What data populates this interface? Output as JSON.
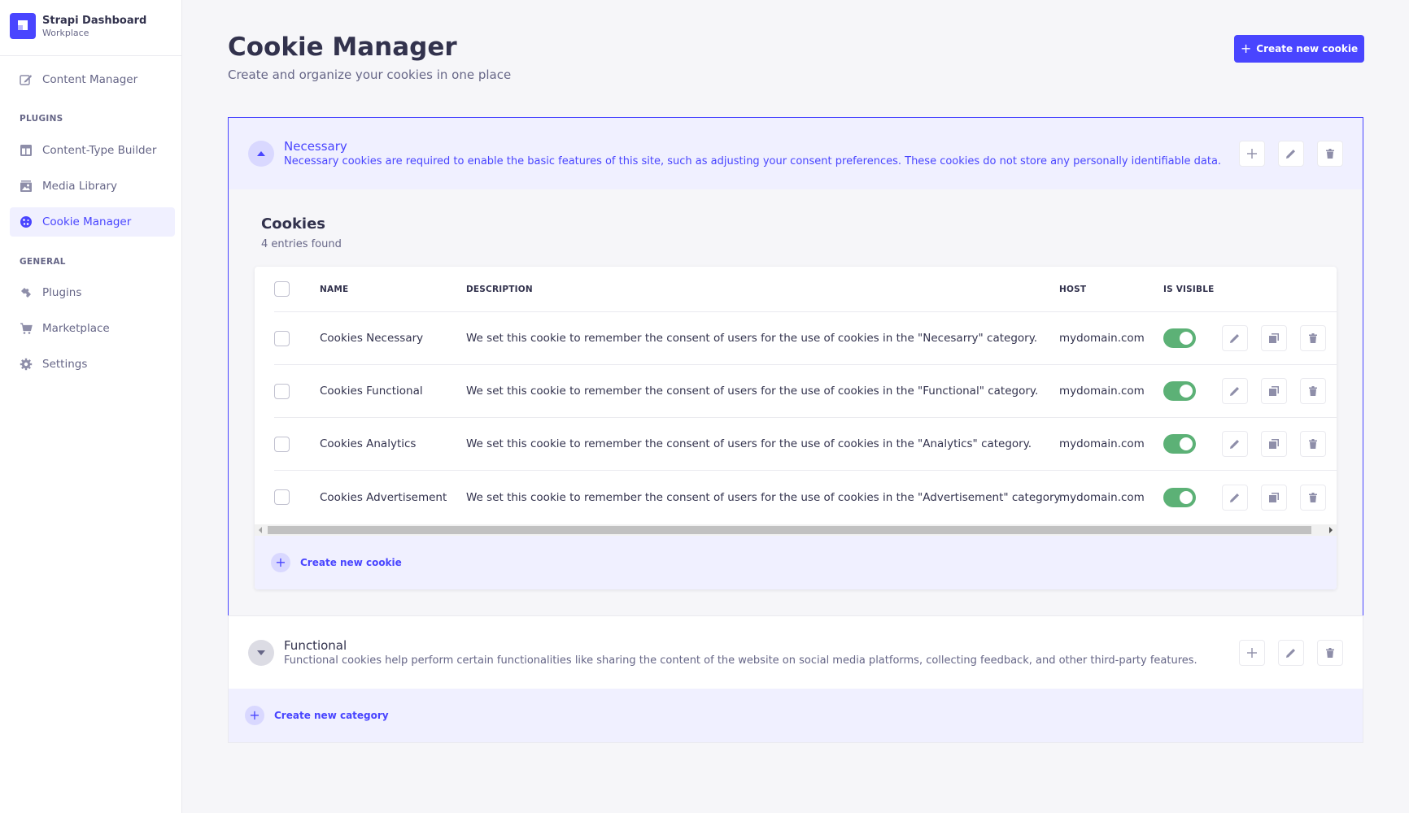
{
  "sidebar": {
    "brand_title": "Strapi Dashboard",
    "brand_subtitle": "Workplace",
    "top_items": [
      {
        "label": "Content Manager",
        "icon": "pen-icon"
      }
    ],
    "plugins_label": "PLUGINS",
    "plugin_items": [
      {
        "label": "Content-Type Builder",
        "icon": "layout-icon"
      },
      {
        "label": "Media Library",
        "icon": "image-icon"
      },
      {
        "label": "Cookie Manager",
        "icon": "cookie-icon",
        "active": true
      }
    ],
    "general_label": "GENERAL",
    "general_items": [
      {
        "label": "Plugins",
        "icon": "puzzle-icon"
      },
      {
        "label": "Marketplace",
        "icon": "cart-icon"
      },
      {
        "label": "Settings",
        "icon": "gear-icon"
      }
    ]
  },
  "header": {
    "title": "Cookie Manager",
    "subtitle": "Create and organize your cookies in one place",
    "create_button": "Create new cookie"
  },
  "categories": [
    {
      "title": "Necessary",
      "description": "Necessary cookies are required to enable the basic features of this site, such as adjusting your consent preferences. These cookies do not store any personally identifiable data.",
      "expanded": true,
      "cookies_title": "Cookies",
      "entries_found": "4 entries found",
      "columns": [
        "NAME",
        "DESCRIPTION",
        "HOST",
        "IS VISIBLE"
      ],
      "rows": [
        {
          "name": "Cookies Necessary",
          "description": "We set this cookie to remember the consent of users for the use of cookies in the \"Necesarry\" category.",
          "host": "mydomain.com",
          "visible": true
        },
        {
          "name": "Cookies Functional",
          "description": "We set this cookie to remember the consent of users for the use of cookies in the \"Functional\" category.",
          "host": "mydomain.com",
          "visible": true
        },
        {
          "name": "Cookies Analytics",
          "description": "We set this cookie to remember the consent of users for the use of cookies in the \"Analytics\" category.",
          "host": "mydomain.com",
          "visible": true
        },
        {
          "name": "Cookies Advertisement",
          "description": "We set this cookie to remember the consent of users for the use of cookies in the \"Advertisement\" category.",
          "host": "mydomain.com",
          "visible": true
        }
      ],
      "create_cookie_label": "Create new cookie"
    },
    {
      "title": "Functional",
      "description": "Functional cookies help perform certain functionalities like sharing the content of the website on social media platforms, collecting feedback, and other third-party features.",
      "expanded": false
    }
  ],
  "create_category_label": "Create new category",
  "colors": {
    "primary": "#4945ff",
    "toggle_on": "#5cb176",
    "active_bg": "#f0f0ff"
  }
}
